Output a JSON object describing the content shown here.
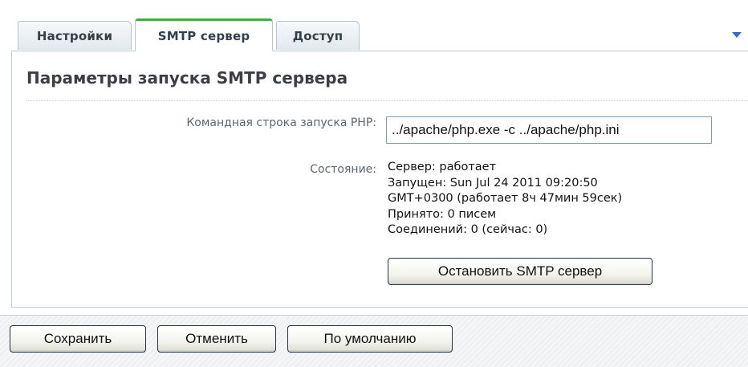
{
  "tabs": [
    {
      "label": "Настройки",
      "active": false
    },
    {
      "label": "SMTP сервер",
      "active": true
    },
    {
      "label": "Доступ",
      "active": false
    }
  ],
  "tabs_menu_icon": "chevron-down-icon",
  "panel": {
    "title": "Параметры запуска SMTP сервера",
    "cmd_label": "Командная строка запуска PHP:",
    "cmd_value": "../apache/php.exe -c ../apache/php.ini",
    "status_label": "Состояние:",
    "status_lines": [
      "Сервер: работает",
      "Запущен: Sun Jul 24 2011 09:20:50",
      "GMT+0300 (работает 8ч 47мин 59сек)",
      "Принято: 0 писем",
      "Соединений: 0 (сейчас: 0)"
    ],
    "stop_button": "Остановить SMTP сервер"
  },
  "footer": {
    "save": "Сохранить",
    "cancel": "Отменить",
    "defaults": "По умолчанию"
  },
  "colors": {
    "active_tab_accent": "#4aa845",
    "menu_arrow": "#3a6bb5"
  }
}
